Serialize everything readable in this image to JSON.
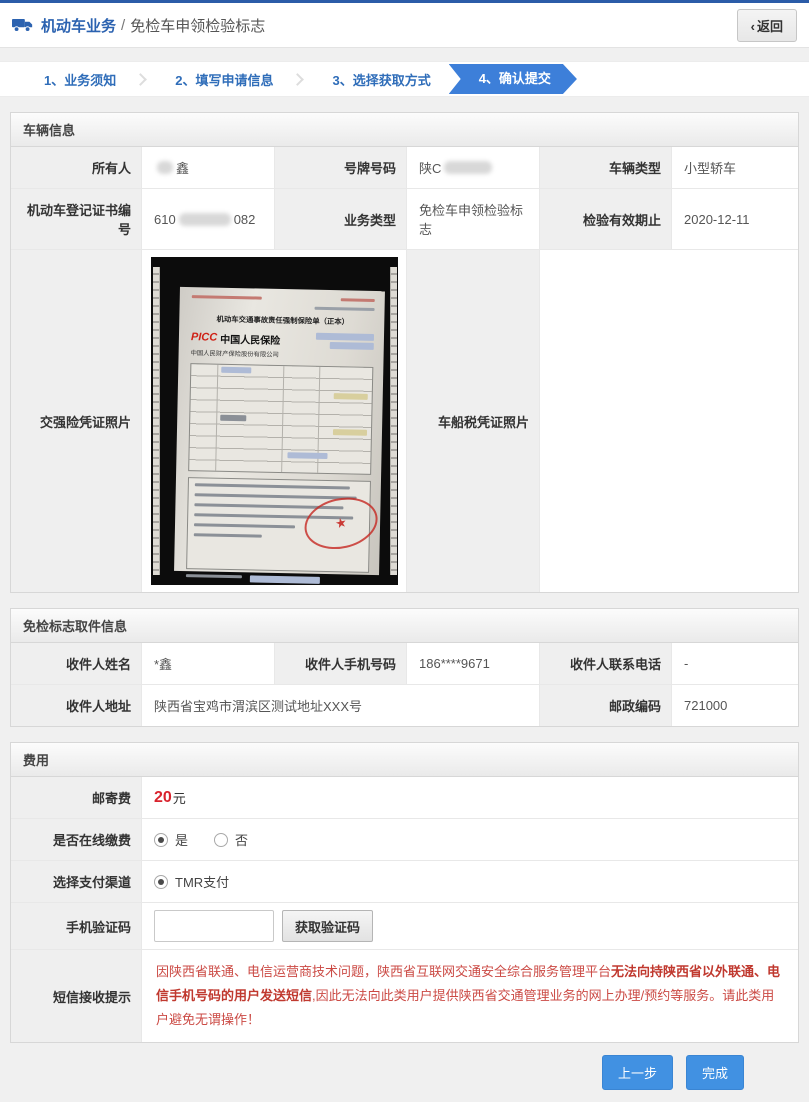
{
  "colors": {
    "accent_blue": "#3d7fd9",
    "title_blue": "#2b62b0",
    "fee_red": "#d9232d",
    "notice_red": "#cb4a44",
    "topline_blue": "#2b5ca8"
  },
  "header": {
    "section_title": "机动车业务",
    "separator": "/",
    "page_title": "免检车申领检验标志",
    "back_chevron": "‹",
    "back_label": "返回"
  },
  "steps": [
    {
      "label": "1、业务须知"
    },
    {
      "label": "2、填写申请信息"
    },
    {
      "label": "3、选择获取方式"
    },
    {
      "label": "4、确认提交"
    }
  ],
  "vehicle_info": {
    "title": "车辆信息",
    "owner_label": "所有人",
    "owner_value": "鑫",
    "plate_label": "号牌号码",
    "plate_value": "陕C",
    "vehicle_type_label": "车辆类型",
    "vehicle_type_value": "小型轿车",
    "cert_label": "机动车登记证书编号",
    "cert_prefix": "610",
    "cert_suffix": "082",
    "business_type_label": "业务类型",
    "business_type_value": "免检车申领检验标志",
    "valid_until_label": "检验有效期止",
    "valid_until_value": "2020-12-11",
    "insurance_photo_label": "交强险凭证照片",
    "tax_photo_label": "车船税凭证照片"
  },
  "insurance_photo": {
    "doc_title": "机动车交通事故责任强制保险单（正本）",
    "brand": "PICC",
    "brand_cn": "中国人民保险",
    "company": "中国人民财产保险股份有限公司",
    "stamp_star": "★"
  },
  "pickup_info": {
    "title": "免检标志取件信息",
    "name_label": "收件人姓名",
    "name_value": "*鑫",
    "phone_label": "收件人手机号码",
    "phone_value": "186****9671",
    "tel_label": "收件人联系电话",
    "tel_value": "-",
    "address_label": "收件人地址",
    "address_value": "陕西省宝鸡市渭滨区测试地址XXX号",
    "postcode_label": "邮政编码",
    "postcode_value": "721000"
  },
  "fees": {
    "title": "费用",
    "postage_label": "邮寄费",
    "postage_amount": "20",
    "postage_unit": "元",
    "online_pay_label": "是否在线缴费",
    "online_pay_yes": "是",
    "online_pay_no": "否",
    "channel_label": "选择支付渠道",
    "channel_option": "TMR支付",
    "sms_code_label": "手机验证码",
    "get_code_button": "获取验证码",
    "notice_label": "短信接收提示",
    "notice_part1": "因陕西省联通、电信运营商技术问题，陕西省互联网交通安全综合服务管理平台",
    "notice_part2": "无法向持陕西省以外联通、电信手机号码的用户发送短信",
    "notice_part3": ",因此无法向此类用户提供陕西省交通管理业务的网上办理/预约等服务。请此类用户避免无谓操作！"
  },
  "footer": {
    "prev_button": "上一步",
    "finish_button": "完成"
  }
}
